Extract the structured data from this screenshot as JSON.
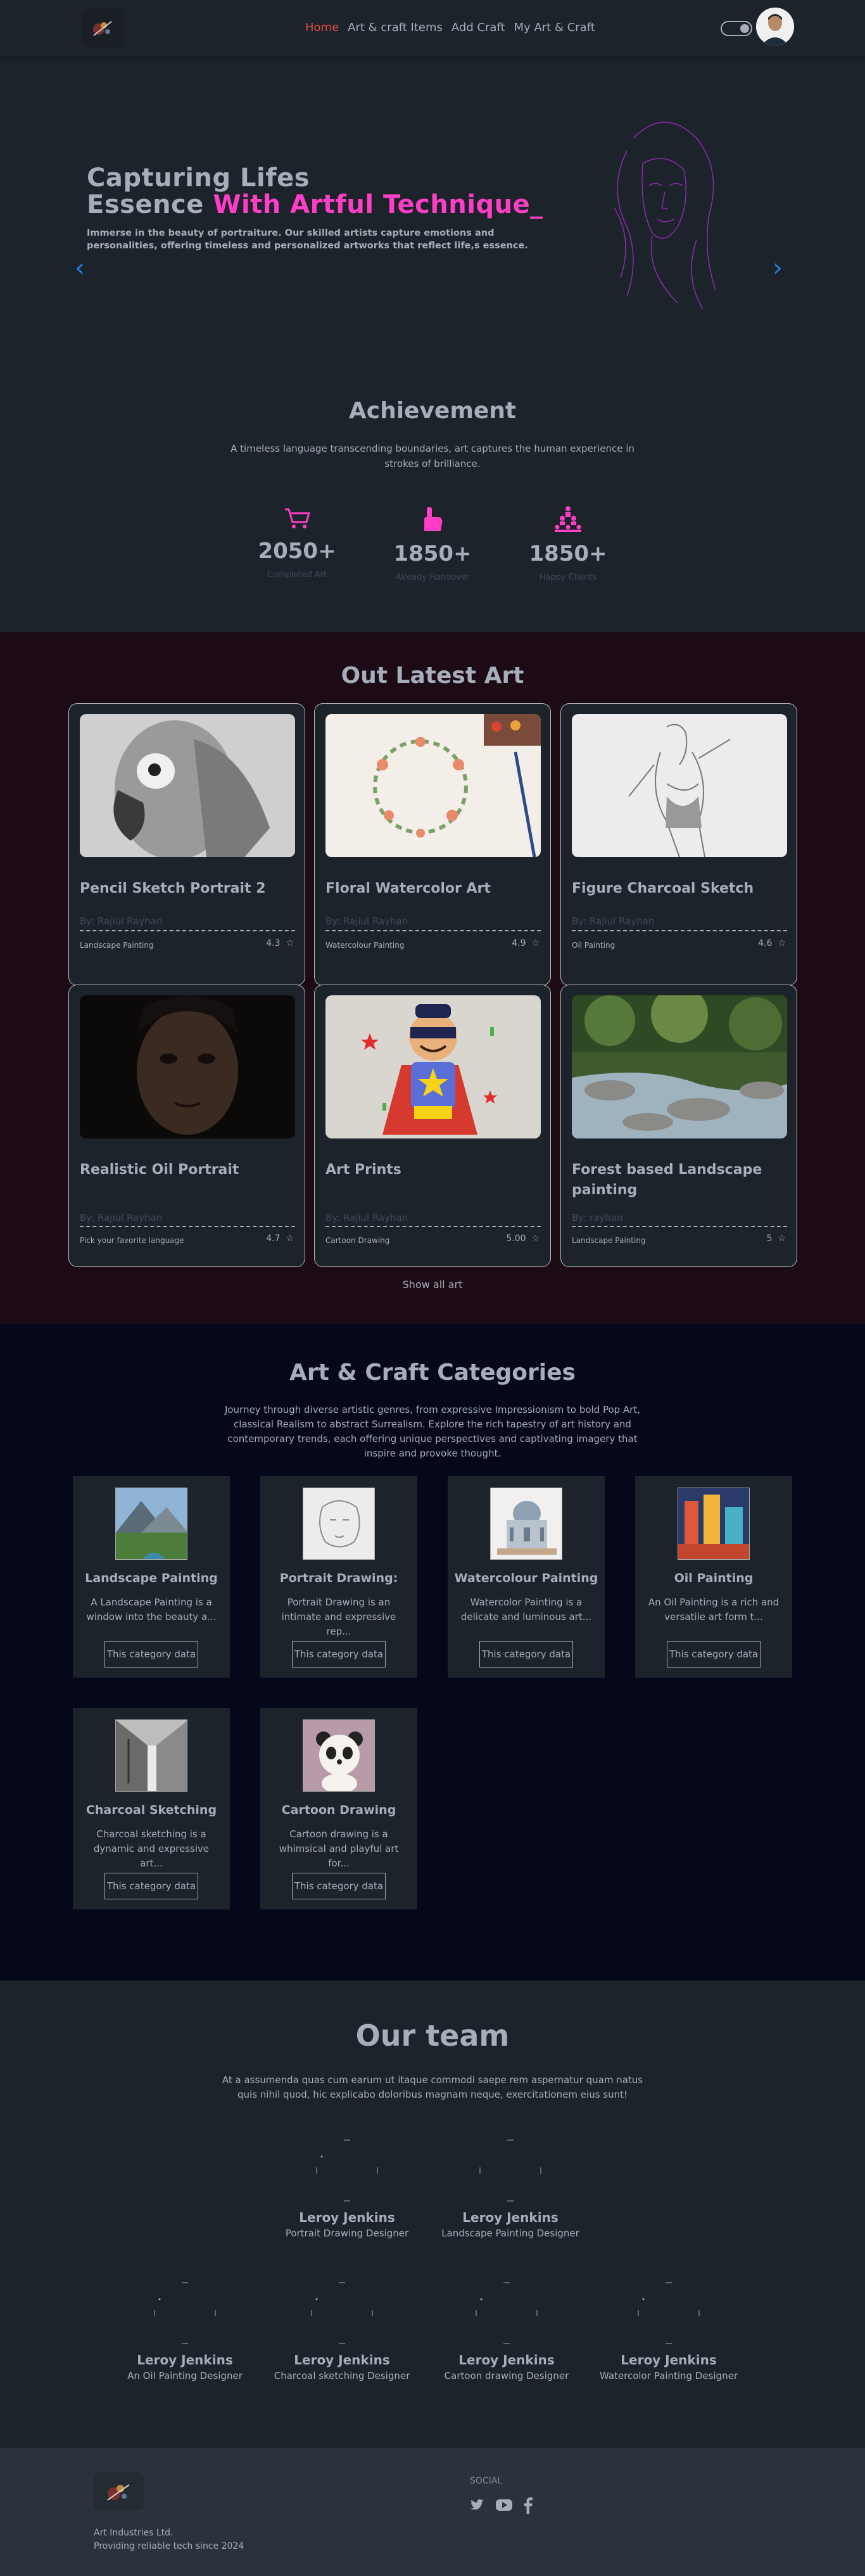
{
  "nav": {
    "links": [
      "Home",
      "Art & craft Items",
      "Add Craft",
      "My Art & Craft"
    ]
  },
  "hero": {
    "title_line1": "Capturing Lifes",
    "title_line2": "Essence",
    "title_highlight": "With Artful Technique_",
    "description": "Immerse in the beauty of portraiture. Our skilled artists capture emotions and personalities, offering timeless and personalized artworks that reflect life,s essence."
  },
  "achievement": {
    "title": "Achievement",
    "description": "A timeless language transcending boundaries, art captures the human experience in strokes of brilliance.",
    "stats": [
      {
        "value": "2050+",
        "label": "Completed Art",
        "icon": "cart-icon"
      },
      {
        "value": "1850+",
        "label": "Already Handover",
        "icon": "hand-icon"
      },
      {
        "value": "1850+",
        "label": "Happy Clients",
        "icon": "people-pyramid-icon"
      }
    ]
  },
  "latest_art": {
    "title": "Out Latest Art",
    "show_all": "Show all art",
    "items": [
      {
        "title": "Pencil Sketch Portrait 2",
        "by": "By: Rajiul Rayhan",
        "category": "Landscape Painting",
        "rating": "4.3"
      },
      {
        "title": "Floral Watercolor Art",
        "by": "By: Rajiul Rayhan",
        "category": "Watercolour Painting",
        "rating": "4.9"
      },
      {
        "title": "Figure Charcoal Sketch",
        "by": "By: Rajiul Rayhan",
        "category": "Oil Painting",
        "rating": "4.6"
      },
      {
        "title": "Realistic Oil Portrait",
        "by": "By: Rajiul Rayhan",
        "category": "Pick your favorite language",
        "rating": "4.7"
      },
      {
        "title": "Art Prints",
        "by": "By: Rajiul Rayhan",
        "category": "Cartoon Drawing",
        "rating": "5.00"
      },
      {
        "title": "Forest based Landscape painting",
        "by": "By: rayhan",
        "category": "Landscape Painting",
        "rating": "5"
      }
    ]
  },
  "categories": {
    "title": "Art & Craft Categories",
    "description": "Journey through diverse artistic genres, from expressive Impressionism to bold Pop Art, classical Realism to abstract Surrealism. Explore the rich tapestry of art history and contemporary trends, each offering unique perspectives and captivating imagery that inspire and provoke thought.",
    "button_label": "This category data",
    "items": [
      {
        "title": "Landscape Painting",
        "desc": "A Landscape Painting is a window into the beauty a..."
      },
      {
        "title": "Portrait Drawing:",
        "desc": "Portrait Drawing is an intimate and expressive rep..."
      },
      {
        "title": "Watercolour Painting",
        "desc": "Watercolor Painting is a delicate and luminous art..."
      },
      {
        "title": "Oil Painting",
        "desc": "An Oil Painting is a rich and versatile art form t..."
      },
      {
        "title": "Charcoal Sketching",
        "desc": "Charcoal sketching is a dynamic and expressive art..."
      },
      {
        "title": "Cartoon Drawing",
        "desc": "Cartoon drawing is a whimsical and playful art for..."
      }
    ]
  },
  "team": {
    "title": "Our team",
    "description": "At a assumenda quas cum earum ut itaque commodi saepe rem aspernatur quam natus quis nihil quod, hic explicabo doloribus magnam neque, exercitationem eius sunt!",
    "members": [
      {
        "name": "Leroy Jenkins",
        "role": "Portrait Drawing Designer"
      },
      {
        "name": "Leroy Jenkins",
        "role": "Landscape Painting Designer"
      },
      {
        "name": "Leroy Jenkins",
        "role": "An Oil Painting Designer"
      },
      {
        "name": "Leroy Jenkins",
        "role": "Charcoal sketching Designer"
      },
      {
        "name": "Leroy Jenkins",
        "role": "Cartoon drawing Designer"
      },
      {
        "name": "Leroy Jenkins",
        "role": "Watercolor Painting Designer"
      }
    ]
  },
  "footer": {
    "company": "Art Industries Ltd.",
    "tagline": "Providing reliable tech since 2024",
    "social_label": "SOCIAL",
    "social_icons": [
      "twitter-icon",
      "youtube-icon",
      "facebook-icon"
    ]
  },
  "colors": {
    "accent_pink": "#ff3ec8",
    "nav_active": "#e24a4a",
    "carousel_blue": "#2b7bd8",
    "art_section_bg": "#1c0a14",
    "category_section_bg": "#04081a"
  }
}
